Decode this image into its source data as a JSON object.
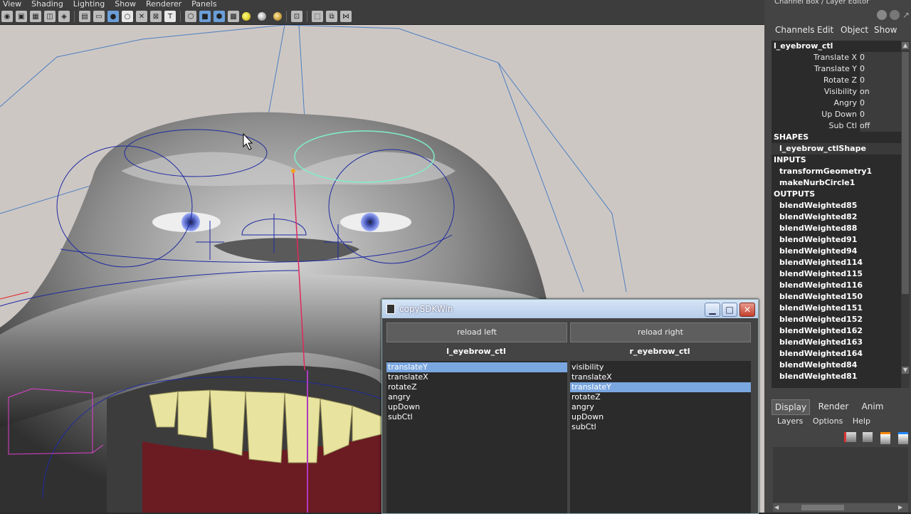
{
  "menubar": [
    "View",
    "Shading",
    "Lighting",
    "Show",
    "Renderer",
    "Panels"
  ],
  "channel_box": {
    "title": "Channel Box / Layer Editor",
    "menu": [
      "Channels",
      "Edit",
      "Object",
      "Show"
    ],
    "node": "l_eyebrow_ctl",
    "attributes": [
      {
        "name": "Translate X",
        "value": "0"
      },
      {
        "name": "Translate Y",
        "value": "0"
      },
      {
        "name": "Rotate Z",
        "value": "0"
      },
      {
        "name": "Visibility",
        "value": "on"
      },
      {
        "name": "Angry",
        "value": "0"
      },
      {
        "name": "Up Down",
        "value": "0"
      },
      {
        "name": "Sub Ctl",
        "value": "off"
      }
    ],
    "shapes_header": "SHAPES",
    "shapes": [
      "l_eyebrow_ctlShape"
    ],
    "inputs_header": "INPUTS",
    "inputs": [
      "transformGeometry1",
      "makeNurbCircle1"
    ],
    "outputs_header": "OUTPUTS",
    "outputs": [
      "blendWeighted85",
      "blendWeighted82",
      "blendWeighted88",
      "blendWeighted91",
      "blendWeighted94",
      "blendWeighted114",
      "blendWeighted115",
      "blendWeighted116",
      "blendWeighted150",
      "blendWeighted151",
      "blendWeighted152",
      "blendWeighted162",
      "blendWeighted163",
      "blendWeighted164",
      "blendWeighted84",
      "blendWeighted81"
    ]
  },
  "layer_editor": {
    "tabs": [
      "Display",
      "Render",
      "Anim"
    ],
    "menu": [
      "Layers",
      "Options",
      "Help"
    ]
  },
  "sdk_window": {
    "title": "copySDKWin",
    "reload_left": "reload left",
    "reload_right": "reload right",
    "left_label": "l_eyebrow_ctl",
    "right_label": "r_eyebrow_ctl",
    "left_items": [
      "translateY",
      "translateX",
      "rotateZ",
      "angry",
      "upDown",
      "subCtl"
    ],
    "left_selected": "translateY",
    "right_items": [
      "visibility",
      "translateX",
      "translateY",
      "rotateZ",
      "angry",
      "upDown",
      "subCtl"
    ],
    "right_selected": "translateY"
  }
}
